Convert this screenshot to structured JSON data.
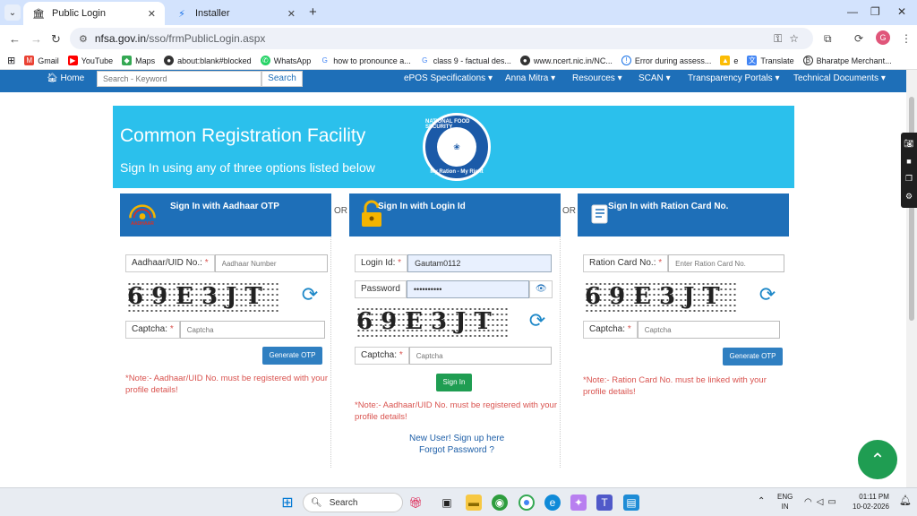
{
  "browser": {
    "tabs": [
      {
        "label": "Public Login",
        "active": true
      },
      {
        "label": "Installer",
        "active": false
      }
    ],
    "url_host": "nfsa.gov.in",
    "url_path": "/sso/frmPublicLogin.aspx",
    "profile_initial": "G",
    "bookmarks": [
      "Gmail",
      "YouTube",
      "Maps",
      "about:blank#blocked",
      "WhatsApp",
      "how to pronounce a...",
      "class 9 - factual des...",
      "www.ncert.nic.in/NC...",
      "Error during assess...",
      "e",
      "Translate",
      "Bharatpe Merchant..."
    ]
  },
  "site_nav": {
    "home": "Home",
    "search_placeholder": "Search - Keyword",
    "search_button": "Search",
    "menu": [
      "ePOS Specifications",
      "Anna Mitra",
      "Resources",
      "SCAN",
      "Transparency Portals",
      "Technical Documents"
    ]
  },
  "hero": {
    "title": "Common Registration Facility",
    "subtitle": "Sign In using any of three options listed below",
    "logo_top": "NATIONAL FOOD SECURITY",
    "logo_bottom": "My Ration - My Right"
  },
  "or_label": "OR",
  "aadhaar": {
    "title": "Sign In with Aadhaar OTP",
    "icon_text": "AADHAAR",
    "id_label": "Aadhaar/UID No.:",
    "id_placeholder": "Aadhaar Number",
    "captcha_text": "69E3JT",
    "captcha_label": "Captcha:",
    "captcha_placeholder": "Captcha",
    "button": "Generate OTP",
    "note": "*Note:- Aadhaar/UID No. must be registered with your profile details!"
  },
  "login": {
    "title": "Sign In with Login Id",
    "id_label": "Login Id:",
    "id_value": "Gautam0112",
    "password_label": "Password",
    "password_value": "••••••••••",
    "captcha_text": "69E3JT",
    "captcha_label": "Captcha:",
    "captcha_placeholder": "Captcha",
    "button": "Sign In",
    "note": "*Note:- Aadhaar/UID No. must be registered with your profile details!",
    "signup_link": "New User! Sign up here",
    "forgot_link": "Forgot Password ?"
  },
  "ration": {
    "title": "Sign In with Ration Card No.",
    "id_label": "Ration Card No.:",
    "id_placeholder": "Enter Ration Card No.",
    "captcha_text": "69E3JT",
    "captcha_label": "Captcha:",
    "captcha_placeholder": "Captcha",
    "button": "Generate OTP",
    "note": "*Note:- Ration Card No. must be linked with your profile details!"
  },
  "taskbar": {
    "search_label": "Search",
    "lang_line1": "ENG",
    "lang_line2": "IN",
    "time": "01:11 PM",
    "date": "10-02-2026"
  },
  "colors": {
    "nav_blue": "#1e6fb8",
    "hero_cyan": "#2bc0ec",
    "note_red": "#d9534f",
    "signin_green": "#1f9d52"
  }
}
